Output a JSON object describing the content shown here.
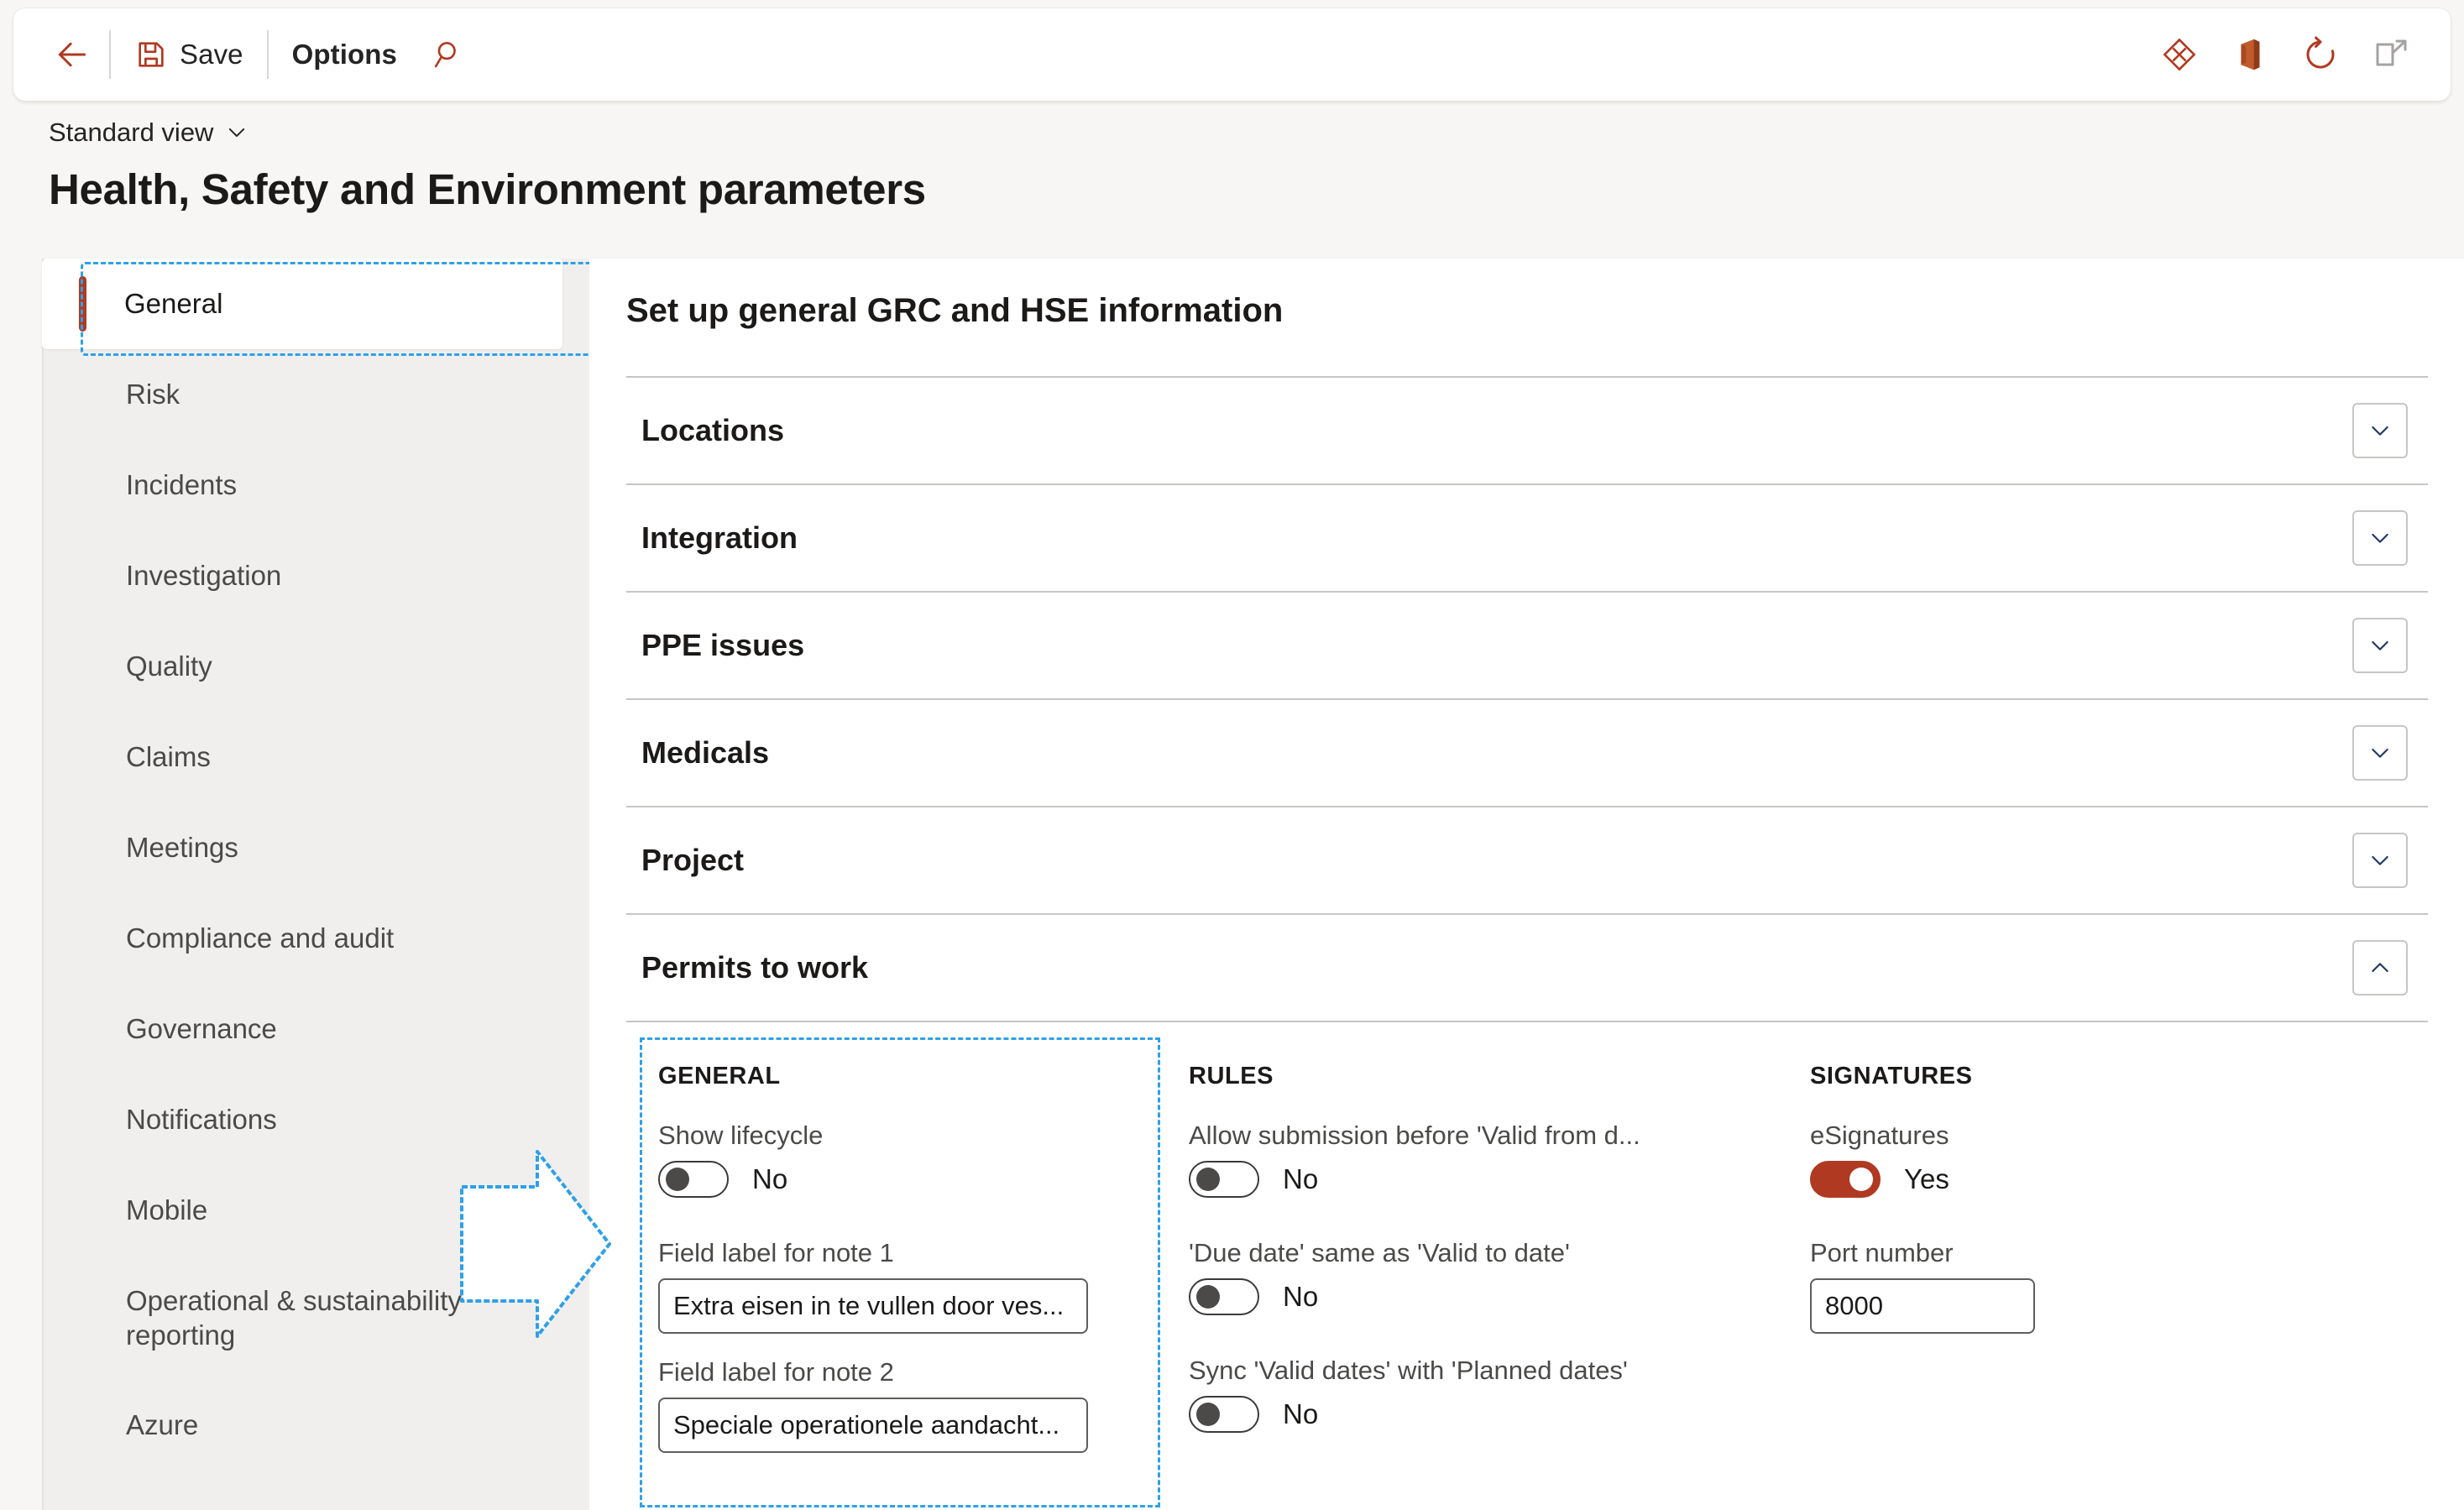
{
  "toolbar": {
    "back_label": "Back",
    "save_label": "Save",
    "options_label": "Options",
    "search_label": "Search",
    "personalize_label": "Personalize",
    "office_label": "Open in Microsoft Office",
    "refresh_label": "Refresh",
    "popout_label": "Open in new window",
    "accent_color": "#B03A21"
  },
  "header": {
    "view_selector": "Standard view",
    "page_title": "Health, Safety and Environment parameters"
  },
  "sidebar": {
    "items": [
      {
        "label": "General",
        "selected": true
      },
      {
        "label": "Risk",
        "selected": false
      },
      {
        "label": "Incidents",
        "selected": false
      },
      {
        "label": "Investigation",
        "selected": false
      },
      {
        "label": "Quality",
        "selected": false
      },
      {
        "label": "Claims",
        "selected": false
      },
      {
        "label": "Meetings",
        "selected": false
      },
      {
        "label": "Compliance and audit",
        "selected": false
      },
      {
        "label": "Governance",
        "selected": false
      },
      {
        "label": "Notifications",
        "selected": false
      },
      {
        "label": "Mobile",
        "selected": false
      },
      {
        "label": "Operational & sustainability reporting",
        "selected": false
      },
      {
        "label": "Azure",
        "selected": false
      }
    ]
  },
  "main": {
    "heading": "Set up general GRC and HSE information",
    "sections": [
      {
        "title": "Locations",
        "expanded": false,
        "chevron": "chevron-down"
      },
      {
        "title": "Integration",
        "expanded": false,
        "chevron": "chevron-down"
      },
      {
        "title": "PPE issues",
        "expanded": false,
        "chevron": "chevron-down"
      },
      {
        "title": "Medicals",
        "expanded": false,
        "chevron": "chevron-down"
      },
      {
        "title": "Project",
        "expanded": false,
        "chevron": "chevron-down"
      },
      {
        "title": "Permits to work",
        "expanded": true,
        "chevron": "chevron-up"
      }
    ],
    "permits_to_work": {
      "general": {
        "heading": "GENERAL",
        "show_lifecycle": {
          "label": "Show lifecycle",
          "value": "No",
          "on": false
        },
        "note1": {
          "label": "Field label for note 1",
          "value": "Extra eisen in te vullen door ves..."
        },
        "note2": {
          "label": "Field label for note 2",
          "value": "Speciale operationele aandacht..."
        }
      },
      "rules": {
        "heading": "RULES",
        "toggles": [
          {
            "label": "Allow submission before 'Valid from d...",
            "value": "No",
            "on": false
          },
          {
            "label": "'Due date' same as 'Valid to date'",
            "value": "No",
            "on": false
          },
          {
            "label": "Sync 'Valid dates' with 'Planned dates'",
            "value": "No",
            "on": false
          }
        ]
      },
      "signatures": {
        "heading": "SIGNATURES",
        "esignatures": {
          "label": "eSignatures",
          "value": "Yes",
          "on": true
        },
        "port": {
          "label": "Port number",
          "value": "8000"
        }
      }
    }
  },
  "annotations": {
    "arrow_color": "#2EA0E8",
    "highlight_color": "#2EA0E8"
  }
}
